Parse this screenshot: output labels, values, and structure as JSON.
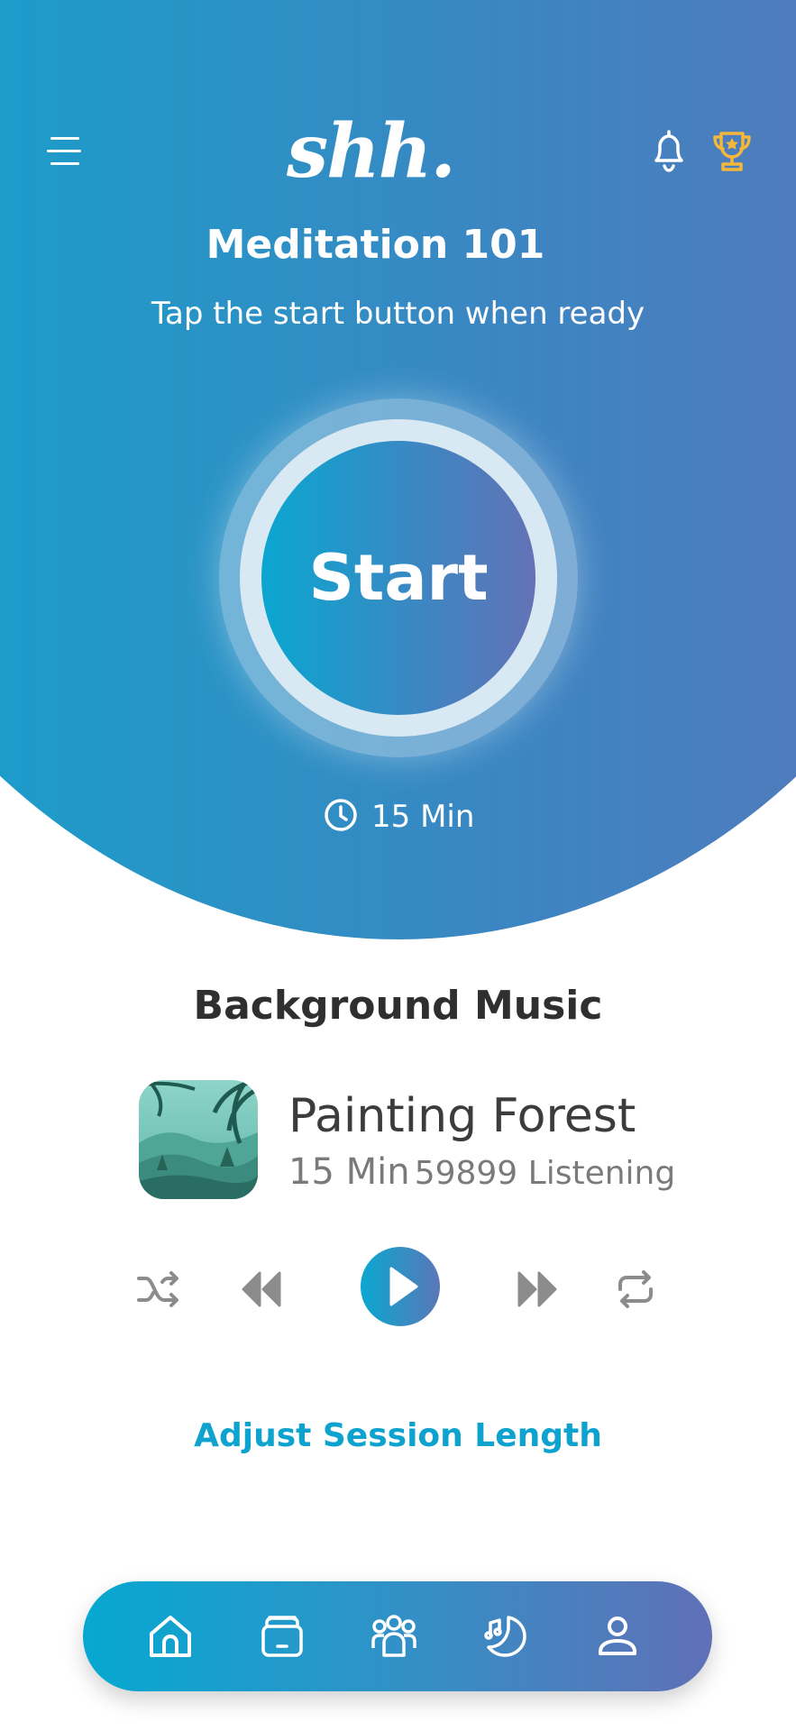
{
  "app": {
    "logo_text": "shh.",
    "accent_color": "#0ea3cf",
    "gradient_colors": [
      "#0ea6cf",
      "#5f73b7"
    ],
    "trophy_color": "#f3b73c"
  },
  "header": {
    "menu_icon": "hamburger-menu-icon",
    "notifications_icon": "bell-icon",
    "achievements_icon": "trophy-icon"
  },
  "session": {
    "title": "Meditation 101",
    "subtitle": "Tap the start button when ready",
    "start_label": "Start",
    "duration_icon": "clock-icon",
    "duration": "15 Min"
  },
  "music": {
    "section_title": "Background Music",
    "track": {
      "title": "Painting Forest",
      "duration": "15 Min",
      "listeners": "59899 Listening"
    },
    "controls": [
      "shuffle-icon",
      "previous-icon",
      "play-icon",
      "next-icon",
      "repeat-icon"
    ]
  },
  "adjust_link": "Adjust Session Length",
  "bottom_nav": {
    "items": [
      "home-icon",
      "library-icon",
      "community-icon",
      "sleep-icon",
      "profile-icon"
    ],
    "active": "home-icon"
  }
}
